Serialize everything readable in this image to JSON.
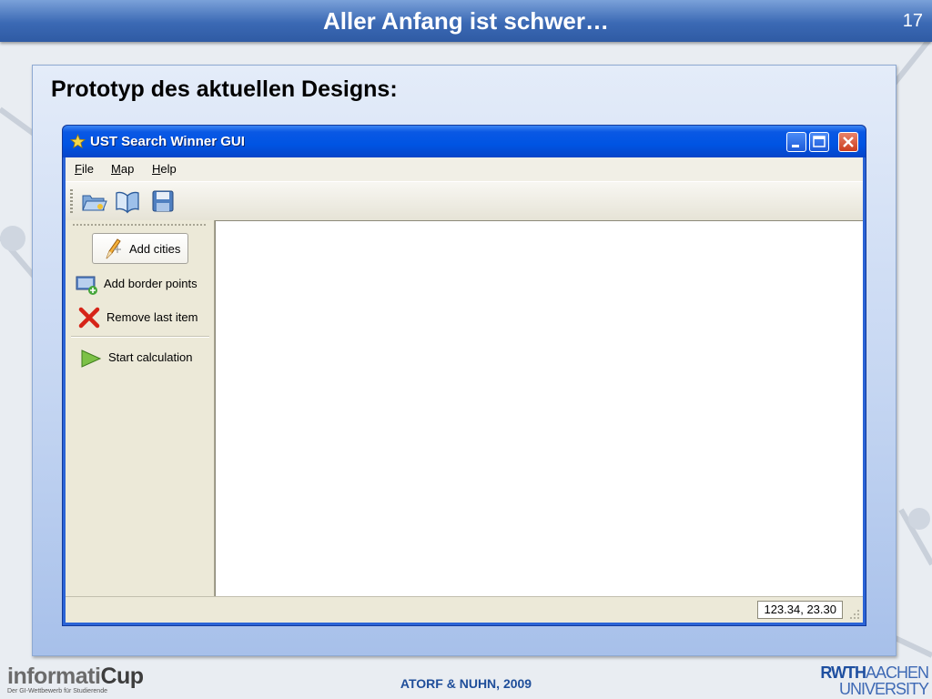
{
  "slide": {
    "title": "Aller Anfang ist schwer…",
    "number": "17",
    "heading": "Prototyp des aktuellen Designs:",
    "footer_text": "ATORF & NUHN, 2009",
    "logo_left": {
      "main_a": "informati",
      "main_b": "Cup",
      "subtitle": "Der GI-Wettbewerb für Studierende"
    },
    "logo_right": {
      "line1_a": "RWTH",
      "line1_b": "AACHEN",
      "line2": "UNIVERSITY"
    }
  },
  "window": {
    "title": "UST Search Winner GUI",
    "controls": [
      "minimize",
      "maximize",
      "close"
    ],
    "menu": [
      {
        "label_u": "F",
        "label_rest": "ile"
      },
      {
        "label_u": "M",
        "label_rest": "ap"
      },
      {
        "label_u": "H",
        "label_rest": "elp"
      }
    ],
    "toolbar_icons": [
      "open-folder-icon",
      "open-book-icon",
      "save-disk-icon"
    ],
    "sidebar": {
      "add_cities": "Add cities",
      "add_border_points": "Add border points",
      "remove_last_item": "Remove last item",
      "start_calculation": "Start calculation"
    },
    "status": {
      "coords": "123.34, 23.30"
    }
  },
  "colors": {
    "header_blue": "#3b69b4",
    "xp_titlebar": "#0054e3",
    "close_red": "#cb3d1e",
    "footer_blue": "#1f4e9a"
  }
}
